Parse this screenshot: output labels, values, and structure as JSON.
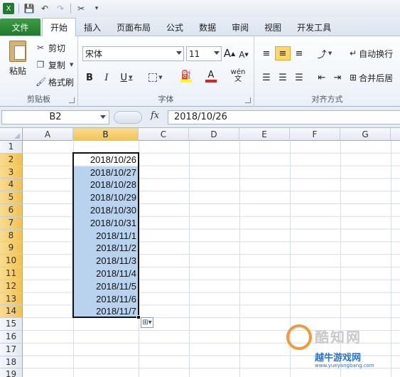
{
  "ribbon_tabs": [
    "文件",
    "开始",
    "插入",
    "页面布局",
    "公式",
    "数据",
    "审阅",
    "视图",
    "开发工具"
  ],
  "clipboard": {
    "paste": "粘贴",
    "cut": "剪切",
    "copy": "复制",
    "format_painter": "格式刷",
    "group_label": "剪贴板"
  },
  "font": {
    "name": "宋体",
    "size": "11",
    "group_label": "字体",
    "bold": "B",
    "italic": "I",
    "underline": "U",
    "grow": "A",
    "shrink": "A",
    "font_color": "A",
    "wen": "wén"
  },
  "alignment": {
    "wrap_text": "自动换行",
    "merge_center": "合并后居",
    "group_label": "对齐方式"
  },
  "formula_bar": {
    "name_box": "B2",
    "fx": "fx",
    "content": "2018/10/26"
  },
  "columns": [
    "A",
    "B",
    "C",
    "D",
    "E",
    "F",
    "G"
  ],
  "rows": [
    "1",
    "2",
    "3",
    "4",
    "5",
    "6",
    "7",
    "8",
    "9",
    "10",
    "11",
    "12",
    "13",
    "14",
    "15",
    "16",
    "17",
    "18",
    "19"
  ],
  "column_b_values": [
    "2018/10/26",
    "2018/10/27",
    "2018/10/28",
    "2018/10/29",
    "2018/10/30",
    "2018/10/31",
    "2018/11/1",
    "2018/11/2",
    "2018/11/3",
    "2018/11/4",
    "2018/11/5",
    "2018/11/6",
    "2018/11/7"
  ],
  "watermark": {
    "text1": "酷知网",
    "text2": "越牛游戏网",
    "text3": "www.yueyangbang.com"
  },
  "colors": {
    "selection": "#b9d3ef",
    "header_selected": "#f1c253",
    "file_tab": "#1f7a2c"
  }
}
